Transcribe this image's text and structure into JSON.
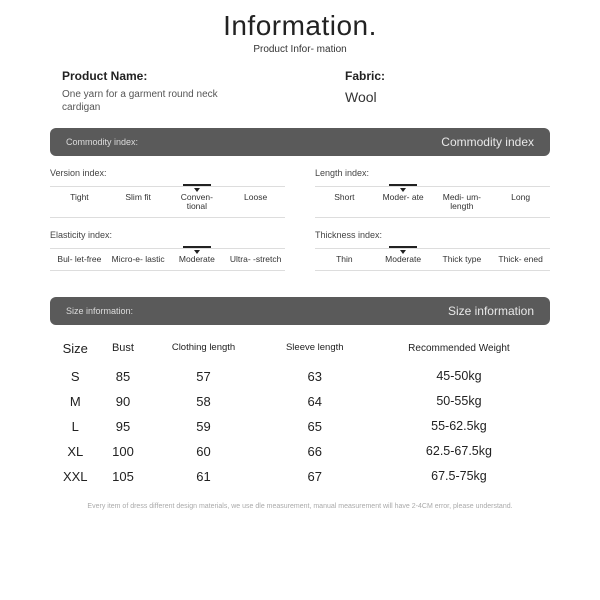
{
  "header": {
    "title": "Information.",
    "subtitle": "Product Infor-\nmation"
  },
  "product": {
    "name_label": "Product Name:",
    "name_value": "One yarn for a garment round neck cardigan",
    "fabric_label": "Fabric:",
    "fabric_value": "Wool"
  },
  "commodity_band": {
    "left": "Commodity index:",
    "right": "Commodity index"
  },
  "size_band": {
    "left": "Size information:",
    "right": "Size information"
  },
  "indices": {
    "version": {
      "title": "Version index:",
      "options": [
        "Tight",
        "Slim fit",
        "Conven-\ntional",
        "Loose"
      ],
      "selected_index": 2
    },
    "length": {
      "title": "Length index:",
      "options": [
        "Short",
        "Moder-\nate",
        "Medi-\num-length",
        "Long"
      ],
      "selected_index": 1
    },
    "elasticity": {
      "title": "Elasticity index:",
      "options": [
        "Bul-\nlet-free",
        "Micro-e-\nlastic",
        "Moderate",
        "Ultra-\n-stretch"
      ],
      "selected_index": 2
    },
    "thickness": {
      "title": "Thickness index:",
      "options": [
        "Thin",
        "Moderate",
        "Thick\ntype",
        "Thick-\nened"
      ],
      "selected_index": 1
    }
  },
  "size_table": {
    "headers": [
      "Size",
      "Bust",
      "Clothing\nlength",
      "Sleeve\nlength",
      "Recommended\nWeight"
    ],
    "rows": [
      {
        "size": "S",
        "bust": "85",
        "clothing_length": "57",
        "sleeve_length": "63",
        "weight": "45-50kg"
      },
      {
        "size": "M",
        "bust": "90",
        "clothing_length": "58",
        "sleeve_length": "64",
        "weight": "50-55kg"
      },
      {
        "size": "L",
        "bust": "95",
        "clothing_length": "59",
        "sleeve_length": "65",
        "weight": "55-62.5kg"
      },
      {
        "size": "XL",
        "bust": "100",
        "clothing_length": "60",
        "sleeve_length": "66",
        "weight": "62.5-67.5kg"
      },
      {
        "size": "XXL",
        "bust": "105",
        "clothing_length": "61",
        "sleeve_length": "67",
        "weight": "67.5-75kg"
      }
    ]
  },
  "footnote": "Every item of dress different design materials, we use dle measurement, manual measurement will have 2-4CM error, please understand."
}
